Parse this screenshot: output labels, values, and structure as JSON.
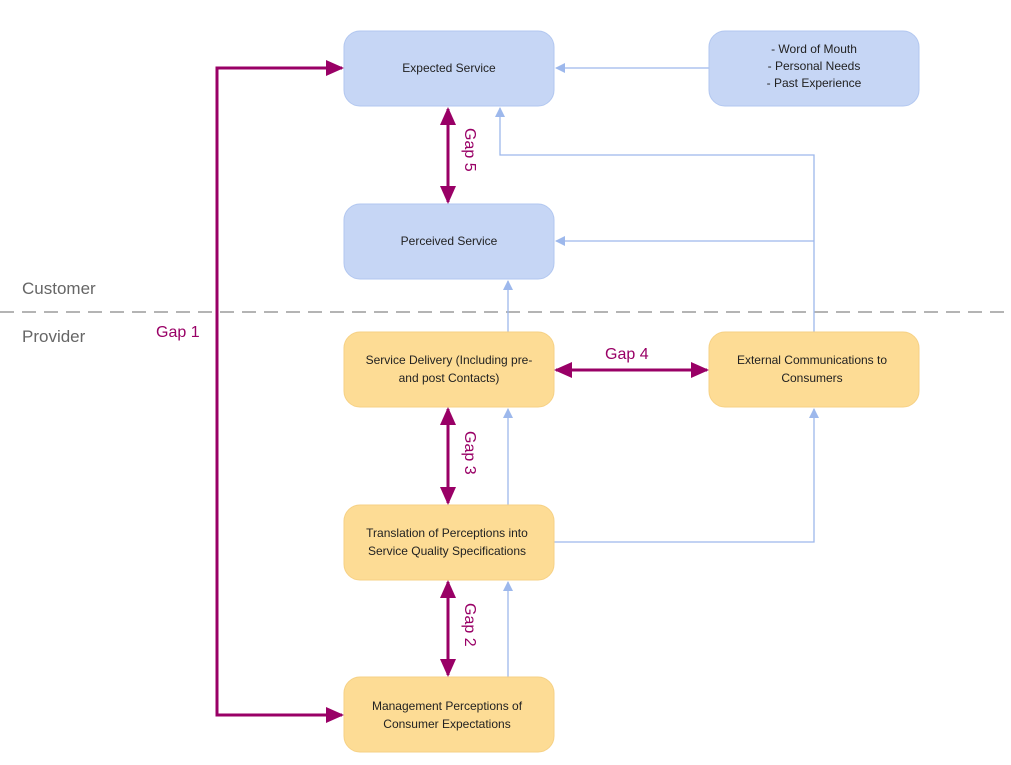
{
  "colors": {
    "customer_box": "#c6d6f5",
    "provider_box": "#fddc95",
    "gap_arrow": "#990066",
    "flow_line": "#9db8ec",
    "divider": "#888888"
  },
  "zones": {
    "customer": "Customer",
    "provider": "Provider"
  },
  "boxes": {
    "expected": [
      "Expected Service"
    ],
    "influences": [
      "- Word of Mouth",
      "- Personal Needs",
      "- Past Experience"
    ],
    "perceived": [
      "Perceived Service"
    ],
    "delivery": [
      "Service Delivery (Including pre-",
      "and post Contacts)"
    ],
    "external": [
      "External Communications to",
      "Consumers"
    ],
    "translation": [
      "Translation of Perceptions into",
      "Service Quality Specifications"
    ],
    "management": [
      "Management Perceptions of",
      "Consumer Expectations"
    ]
  },
  "gaps": {
    "gap1": "Gap 1",
    "gap2": "Gap 2",
    "gap3": "Gap 3",
    "gap4": "Gap 4",
    "gap5": "Gap 5"
  }
}
